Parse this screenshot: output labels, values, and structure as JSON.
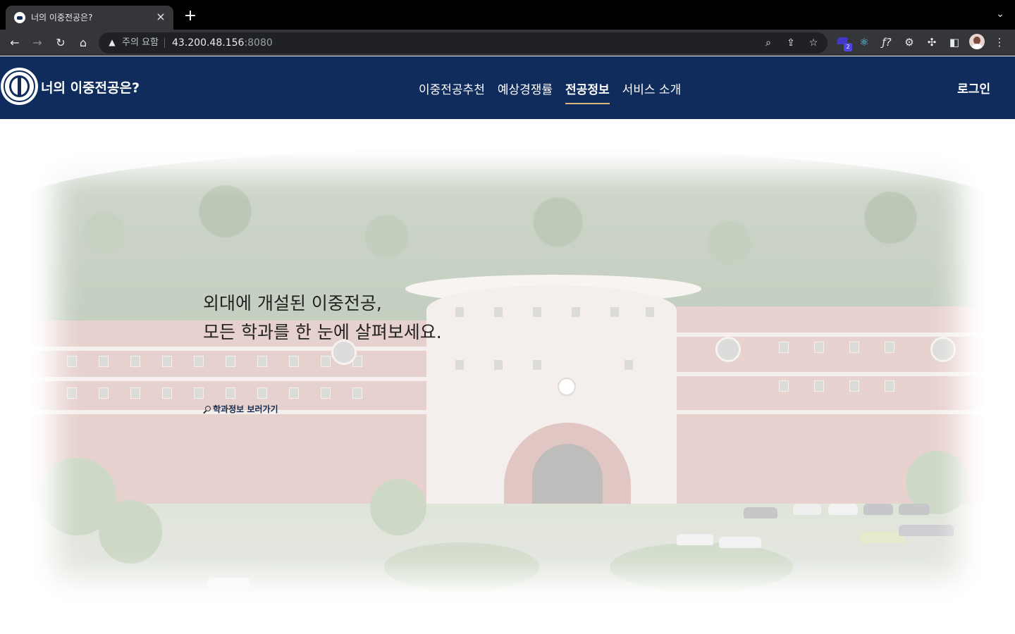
{
  "browser": {
    "tab_title": "너의 이중전공은?",
    "tab_close": "×",
    "new_tab": "+",
    "security_warning": "주의 요함",
    "url_host": "43.200.48.156",
    "url_port": ":8080",
    "extension_badge": "2",
    "icons": [
      "back-icon",
      "forward-icon",
      "reload-icon",
      "home-icon",
      "warning-icon",
      "zoom-icon",
      "share-icon",
      "star-icon",
      "react-icon",
      "formula-icon",
      "gear-icon",
      "puzzle-icon",
      "sidepanel-icon",
      "menu-icon"
    ]
  },
  "site": {
    "brand": "너의 이중전공은?",
    "nav": [
      "이중전공추천",
      "예상경쟁률",
      "전공정보",
      "서비스 소개"
    ],
    "active_nav": "전공정보",
    "login": "로그인",
    "accent": "#0f2c5c"
  },
  "hero": {
    "line1": "외대에 개설된 이중전공,",
    "line2": "모든 학과를 한 눈에 살펴보세요.",
    "link": "학과정보 보러가기"
  }
}
